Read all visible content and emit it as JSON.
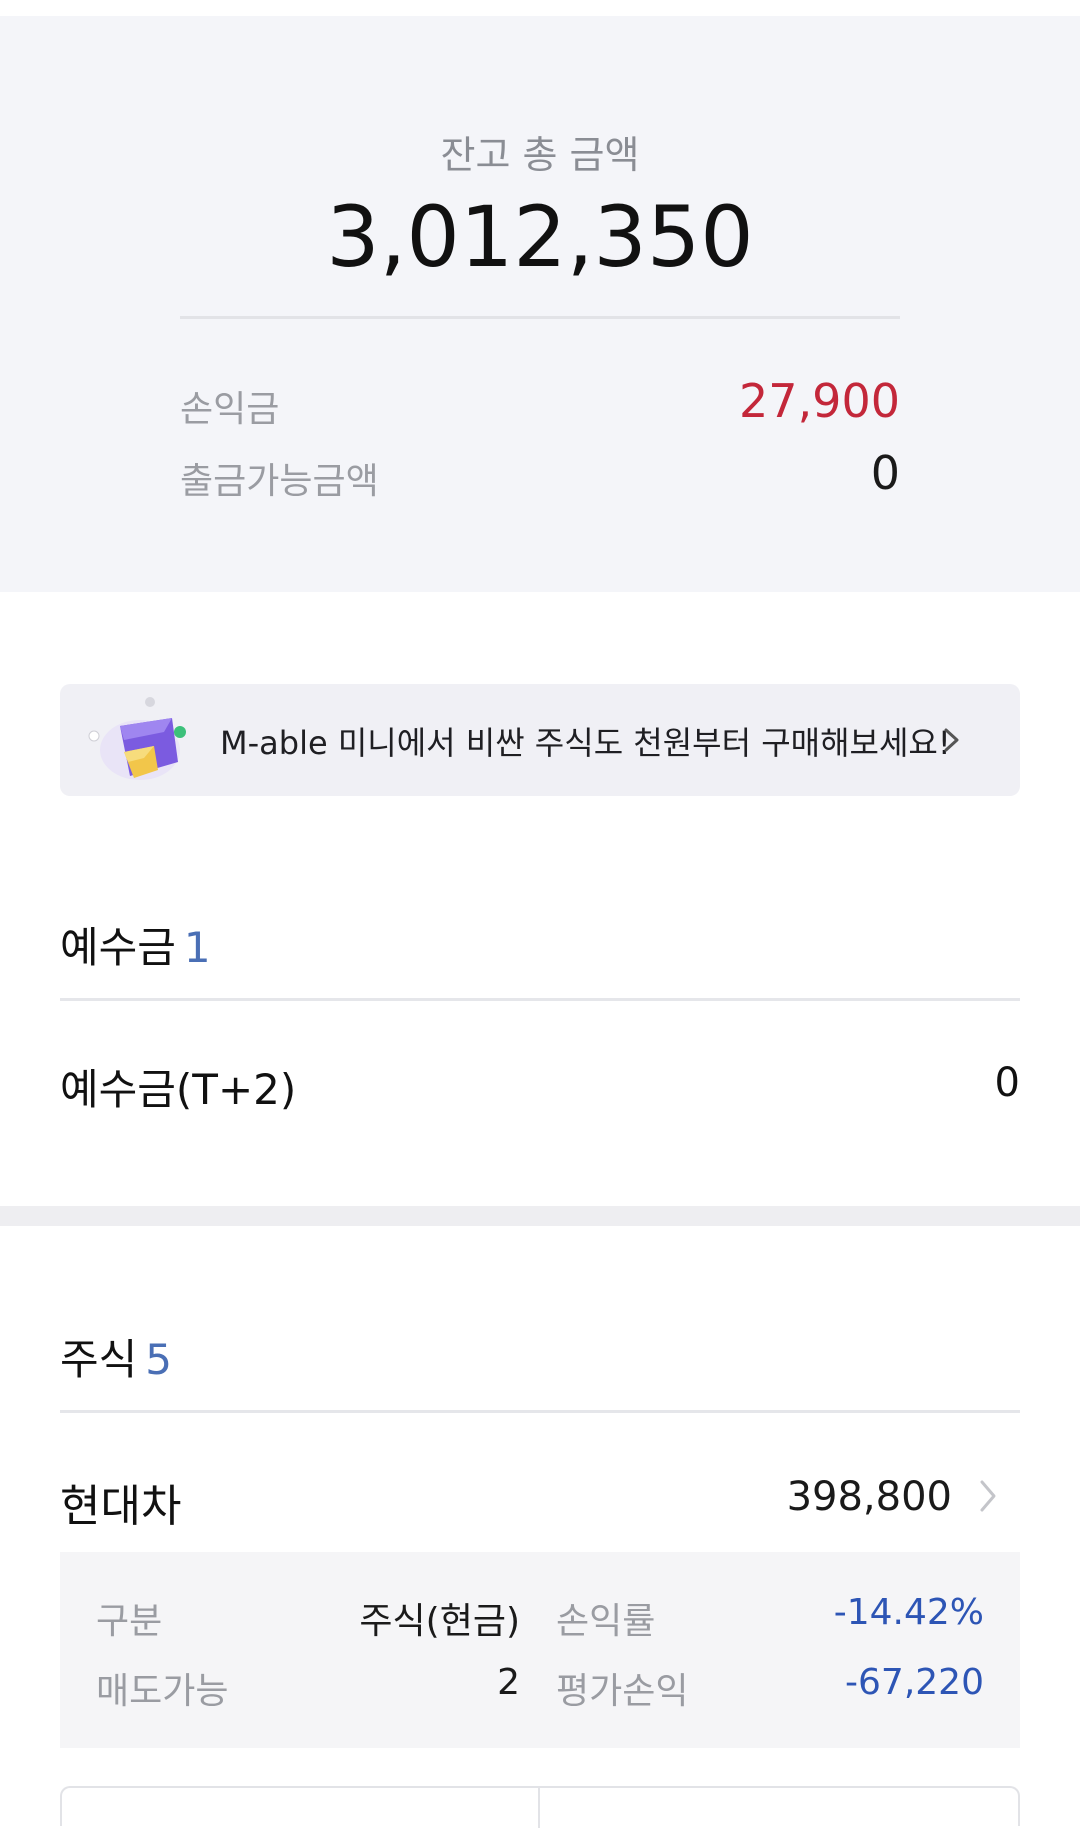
{
  "summary": {
    "title": "잔고 총 금액",
    "total": "3,012,350",
    "profit_label": "손익금",
    "profit_value": "27,900",
    "withdrawable_label": "출금가능금액",
    "withdrawable_value": "0"
  },
  "promo": {
    "text": "M-able 미니에서 비싼 주식도 천원부터 구매해보세요!"
  },
  "deposit": {
    "title": "예수금",
    "count": "1",
    "row_label": "예수금(T+2)",
    "row_value": "0"
  },
  "stocks": {
    "title": "주식",
    "count": "5",
    "items": [
      {
        "name": "현대차",
        "value": "398,800",
        "type_label": "구분",
        "type_value": "주식(현금)",
        "rate_label": "손익률",
        "rate_value": "-14.42%",
        "sellable_label": "매도가능",
        "sellable_value": "2",
        "eval_label": "평가손익",
        "eval_value": "-67,220"
      }
    ]
  },
  "colors": {
    "profit_red": "#c3273a",
    "loss_blue": "#2d55b5",
    "count_blue": "#4a6fb5",
    "summary_bg": "#f4f5f9"
  }
}
